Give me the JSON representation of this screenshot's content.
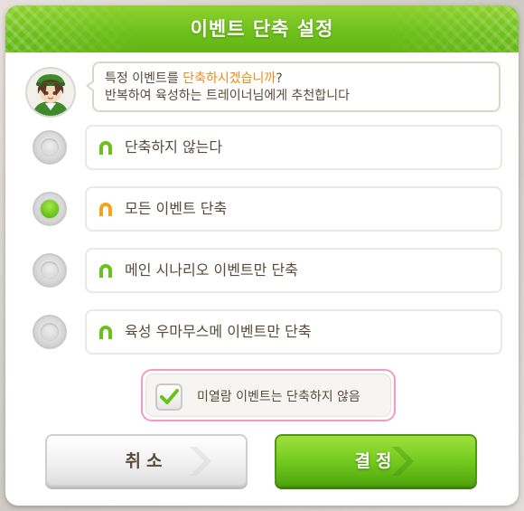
{
  "dialog": {
    "title": "이벤트 단축 설정"
  },
  "prompt": {
    "line1_pre": "특정 이벤트를 ",
    "line1_highlight": "단축하시겠습니까",
    "line1_post": "?",
    "line2": "반복하여 육성하는 트레이너님에게 추천합니다",
    "highlight_color": "#f08a17"
  },
  "options": [
    {
      "label": "단축하지 않는다",
      "selected": false,
      "icon": "horseshoe-icon",
      "icon_color": "#6cc01a"
    },
    {
      "label": "모든 이벤트 단축",
      "selected": true,
      "icon": "horseshoe-icon",
      "icon_color": "#f2a51c"
    },
    {
      "label": "메인 시나리오 이벤트만 단축",
      "selected": false,
      "icon": "horseshoe-icon",
      "icon_color": "#6cc01a"
    },
    {
      "label": "육성 우마무스메 이벤트만 단축",
      "selected": false,
      "icon": "horseshoe-icon",
      "icon_color": "#6cc01a"
    }
  ],
  "checkbox": {
    "label": "미열람 이벤트는 단축하지 않음",
    "checked": true
  },
  "buttons": {
    "cancel": "취소",
    "confirm": "결정"
  },
  "colors": {
    "accent_green": "#6dbf1b",
    "text_brown": "#5a4a3a",
    "check_border_pink": "#f29ac3"
  }
}
